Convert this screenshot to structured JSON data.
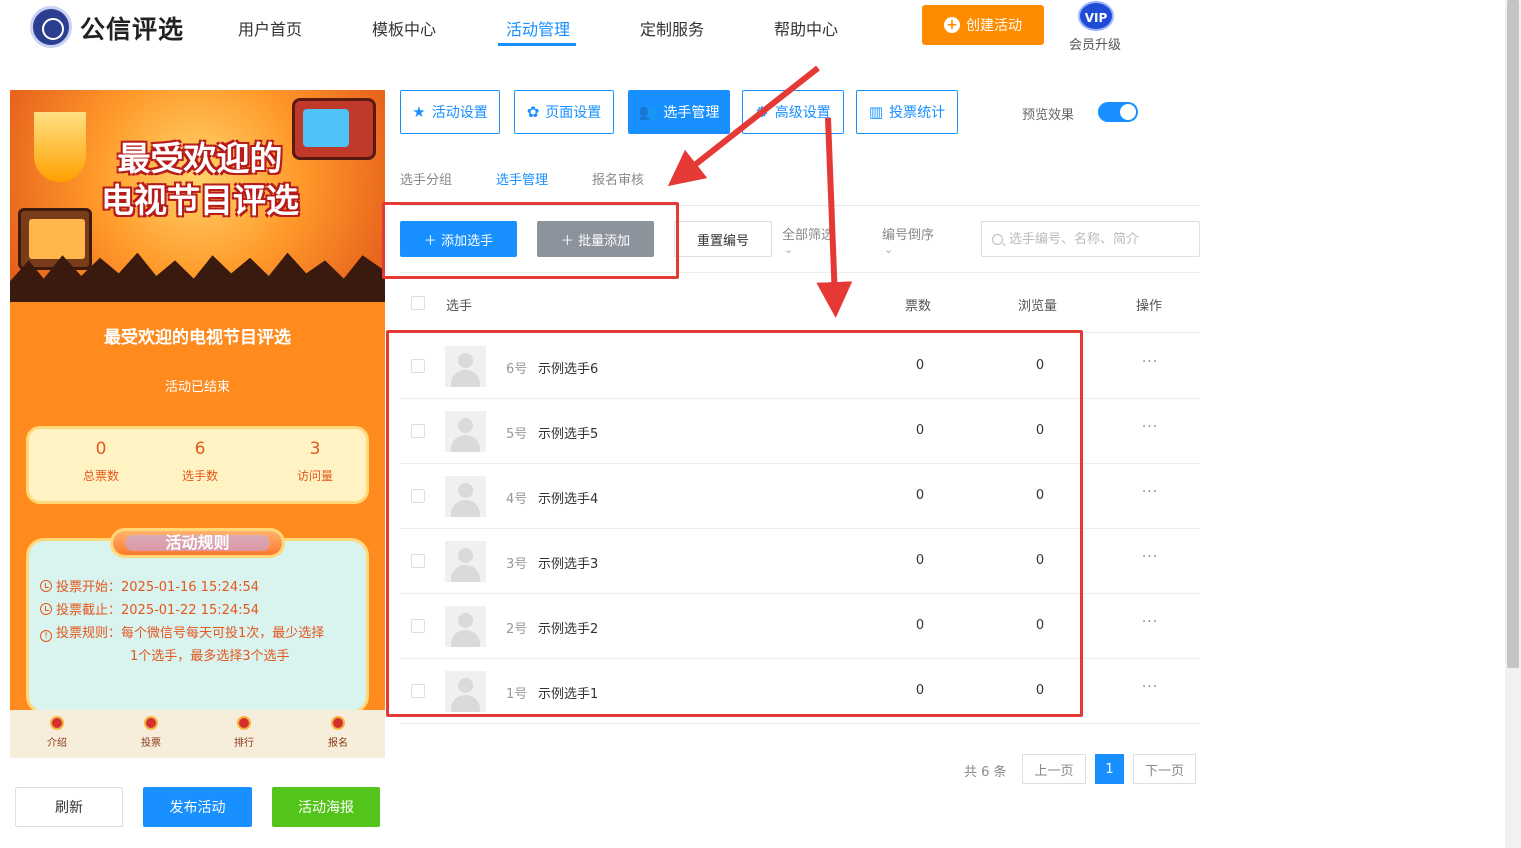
{
  "header": {
    "brand": "公信评选",
    "nav": [
      "用户首页",
      "模板中心",
      "活动管理",
      "定制服务",
      "帮助中心"
    ],
    "active_nav": "活动管理",
    "create_label": "创建活动",
    "vip_badge": "VIP",
    "vip_label": "会员升级",
    "colors": {
      "accent": "#1890ff",
      "create": "#ff8c00"
    }
  },
  "preview": {
    "banner_title_line1": "最受欢迎的",
    "banner_title_line2": "电视节目评选",
    "title": "最受欢迎的电视节目评选",
    "status": "活动已结束",
    "stats": [
      {
        "value": "0",
        "label": "总票数"
      },
      {
        "value": "6",
        "label": "选手数"
      },
      {
        "value": "3",
        "label": "访问量"
      }
    ],
    "rules_title": "活动规则",
    "rules": {
      "start": "投票开始：2025-01-16 15:24:54",
      "end": "投票截止：2025-01-22 15:24:54",
      "rule_line1": "投票规则：每个微信号每天可投1次，最少选择",
      "rule_line2": "1个选手，最多选择3个选手"
    },
    "bottom_nav": [
      "介绍",
      "投票",
      "排行",
      "报名"
    ],
    "actions": {
      "refresh": "刷新",
      "publish": "发布活动",
      "poster": "活动海报"
    }
  },
  "settings_tabs": [
    {
      "label": "活动设置",
      "icon": "star-icon"
    },
    {
      "label": "页面设置",
      "icon": "gear-icon"
    },
    {
      "label": "选手管理",
      "icon": "users-icon"
    },
    {
      "label": "高级设置",
      "icon": "settings-icon"
    },
    {
      "label": "投票统计",
      "icon": "bar-chart-icon"
    }
  ],
  "active_settings_tab": "选手管理",
  "preview_toggle": {
    "label": "预览效果",
    "on": true
  },
  "sub_tabs": [
    "选手分组",
    "选手管理",
    "报名审核"
  ],
  "active_sub_tab": "选手管理",
  "toolbar": {
    "add": "添加选手",
    "batch_add": "批量添加",
    "reset_numbers": "重置编号",
    "filter_all": "全部筛选",
    "sort": "编号倒序",
    "search_placeholder": "选手编号、名称、简介"
  },
  "table": {
    "columns": {
      "contestant": "选手",
      "votes": "票数",
      "views": "浏览量",
      "actions": "操作"
    },
    "more_label": "···",
    "rows": [
      {
        "number": "6号",
        "name": "示例选手6",
        "votes": "0",
        "views": "0"
      },
      {
        "number": "5号",
        "name": "示例选手5",
        "votes": "0",
        "views": "0"
      },
      {
        "number": "4号",
        "name": "示例选手4",
        "votes": "0",
        "views": "0"
      },
      {
        "number": "3号",
        "name": "示例选手3",
        "votes": "0",
        "views": "0"
      },
      {
        "number": "2号",
        "name": "示例选手2",
        "votes": "0",
        "views": "0"
      },
      {
        "number": "1号",
        "name": "示例选手1",
        "votes": "0",
        "views": "0"
      }
    ]
  },
  "pagination": {
    "total": "共 6 条",
    "prev": "上一页",
    "current": "1",
    "next": "下一页"
  },
  "annotation_color": "#e53935"
}
